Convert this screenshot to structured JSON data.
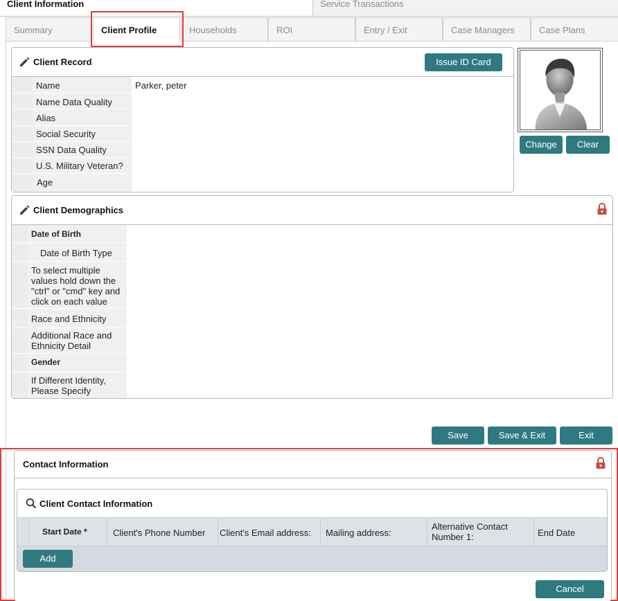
{
  "top_tabs": [
    {
      "label": "Client Information"
    },
    {
      "label": "Service Transactions"
    }
  ],
  "sub_tabs": [
    {
      "label": "Summary"
    },
    {
      "label": "Client Profile"
    },
    {
      "label": "Households"
    },
    {
      "label": "ROI"
    },
    {
      "label": "Entry / Exit"
    },
    {
      "label": "Case Managers"
    },
    {
      "label": "Case Plans"
    }
  ],
  "client_record": {
    "title": "Client Record",
    "issue_id_label": "Issue ID Card",
    "rows": [
      {
        "label": "Name",
        "value": "Parker, peter"
      },
      {
        "label": "Name Data Quality",
        "value": ""
      },
      {
        "label": "Alias",
        "value": ""
      },
      {
        "label": "Social Security",
        "value": ""
      },
      {
        "label": "SSN Data Quality",
        "value": ""
      },
      {
        "label": "U.S. Military Veteran?",
        "value": ""
      },
      {
        "label": "Age",
        "value": ""
      }
    ]
  },
  "photo": {
    "change_label": "Change",
    "clear_label": "Clear"
  },
  "demographics": {
    "title": "Client Demographics",
    "rows": [
      {
        "label": "Date of Birth"
      },
      {
        "label": "Date of Birth Type"
      },
      {
        "label": "To select multiple values hold down the \"ctrl\" or \"cmd\" key and click on each value"
      },
      {
        "label": "Race and Ethnicity"
      },
      {
        "label": "Additional Race and Ethnicity Detail"
      },
      {
        "label": "Gender"
      },
      {
        "label": "If Different Identity, Please Specify"
      }
    ]
  },
  "actions": {
    "save": "Save",
    "save_exit": "Save & Exit",
    "exit": "Exit"
  },
  "contact": {
    "title": "Contact Information",
    "sub_title": "Client Contact Information",
    "columns": [
      "Start Date *",
      "Client's Phone Number",
      "Client's Email address:",
      "Mailing address:",
      "Alternative Contact Number 1:",
      "End Date"
    ],
    "add_label": "Add",
    "cancel_label": "Cancel"
  },
  "colors": {
    "accent": "#2f7a80",
    "highlight": "#e03c3c",
    "lock": "#c0504d"
  }
}
